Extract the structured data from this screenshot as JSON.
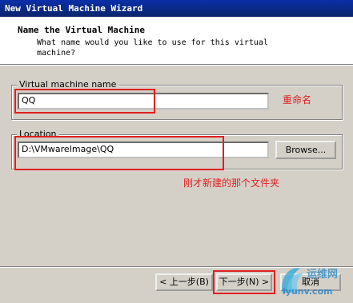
{
  "window": {
    "title": "New Virtual Machine Wizard"
  },
  "header": {
    "title": "Name the Virtual Machine",
    "description": "What name would you like to use for this virtual machine?"
  },
  "name_group": {
    "legend": "Virtual machine name",
    "value": "QQ",
    "annotation": "重命名"
  },
  "location_group": {
    "legend": "Location",
    "value": "D:\\VMwareImage\\QQ",
    "browse_label": "Browse...",
    "annotation": "刚才新建的那个文件夹"
  },
  "footer": {
    "back_label": "< 上一步(B)",
    "next_label": "下一步(N) >",
    "cancel_label": "取消"
  },
  "watermark": {
    "text": "运维网",
    "url_text": "iyunv.com"
  },
  "colors": {
    "annotation": "#e02020",
    "titlebar": "#0a246a"
  }
}
